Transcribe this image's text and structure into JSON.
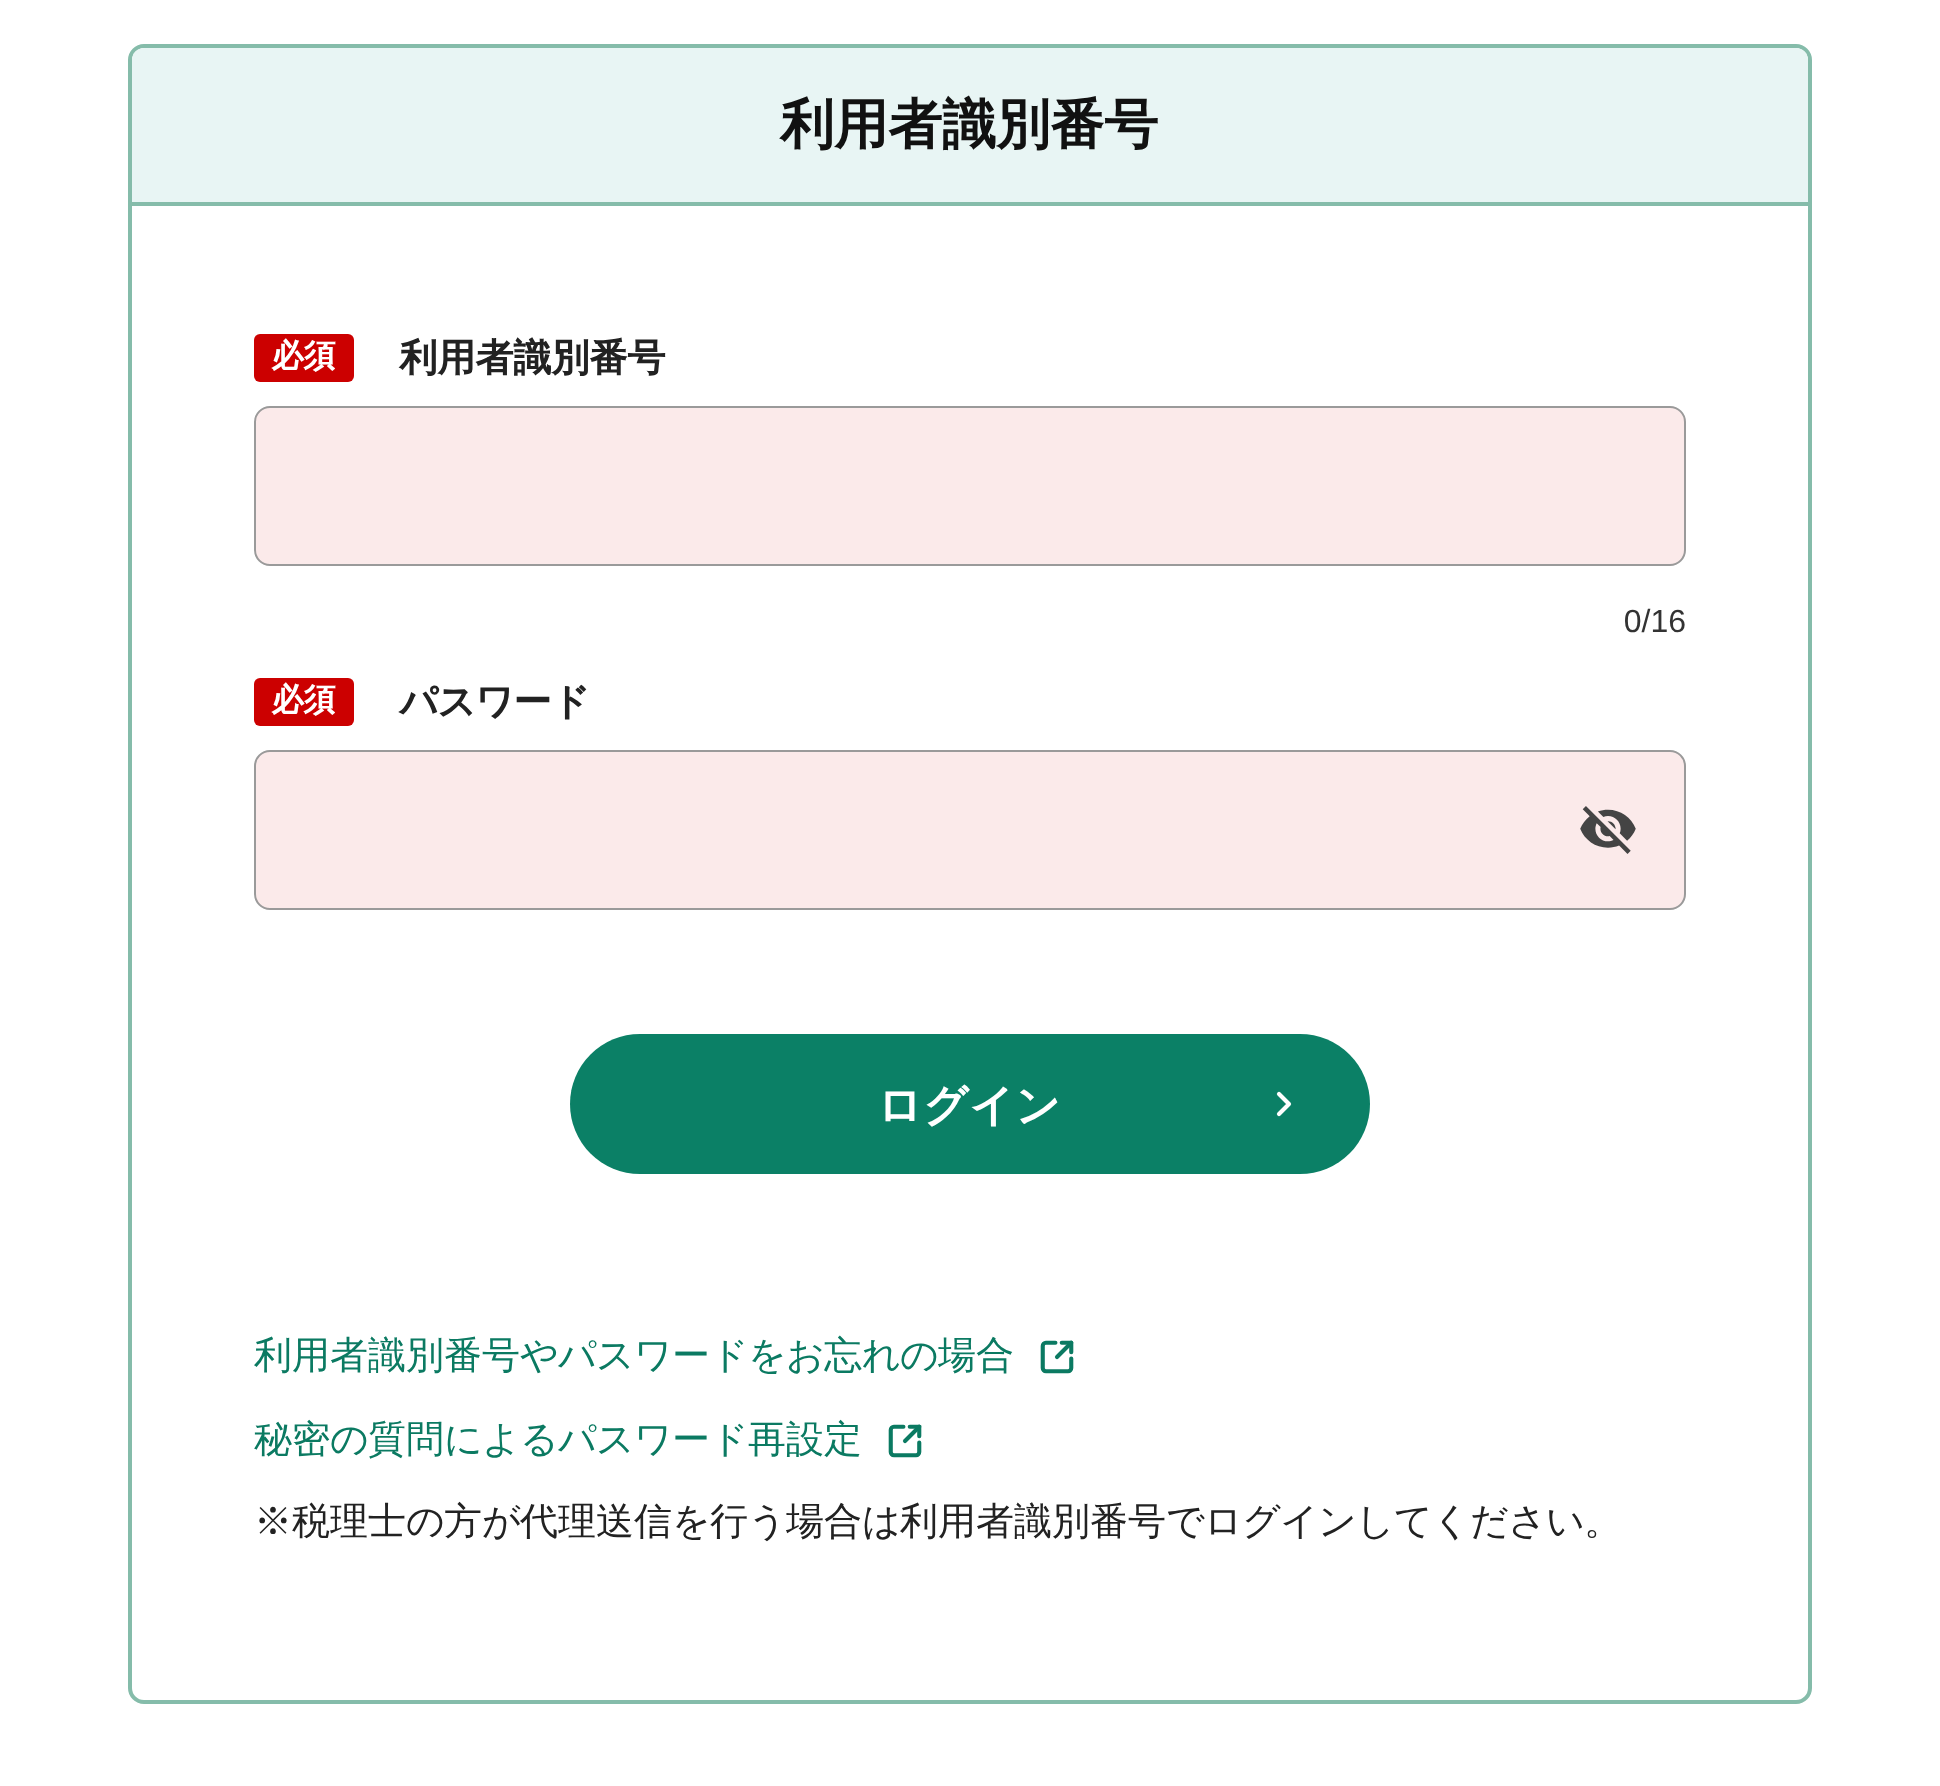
{
  "header": {
    "title": "利用者識別番号"
  },
  "fields": [
    {
      "kind": "text",
      "required_badge": "必須",
      "label": "利用者識別番号",
      "counter": "0/16"
    },
    {
      "kind": "password",
      "required_badge": "必須",
      "label": "パスワード",
      "masked": true
    }
  ],
  "login_button": {
    "label": "ログイン"
  },
  "links": [
    {
      "label": "利用者識別番号やパスワードをお忘れの場合",
      "external": true
    },
    {
      "label": "秘密の質問によるパスワード再設定",
      "external": true
    }
  ],
  "note": "※税理士の方が代理送信を行う場合は利用者識別番号でログインしてください。"
}
